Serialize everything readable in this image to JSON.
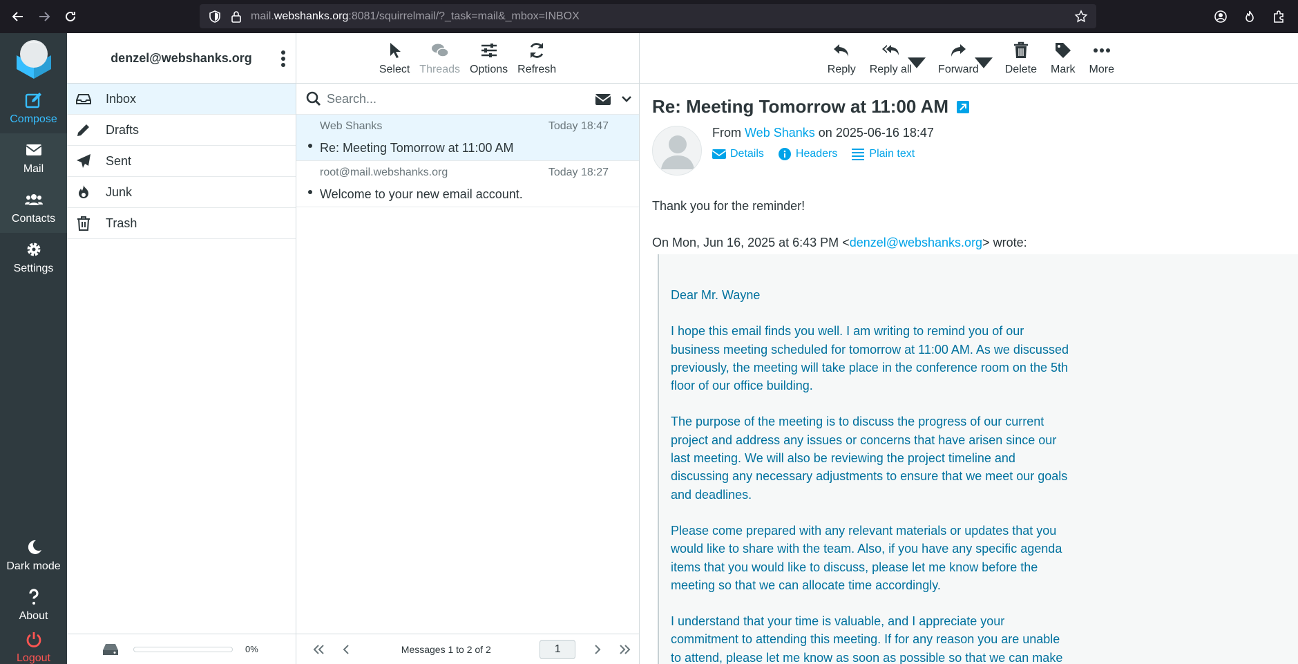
{
  "browser": {
    "url_host": "mail.webshanks.org",
    "url_rest": ":8081/squirrelmail/?_task=mail&_mbox=INBOX",
    "url_prefix": "mail."
  },
  "taskmenu": {
    "items": [
      {
        "label": "Compose",
        "icon": "compose-icon"
      },
      {
        "label": "Mail",
        "icon": "envelope-icon"
      },
      {
        "label": "Contacts",
        "icon": "users-icon"
      },
      {
        "label": "Settings",
        "icon": "gear-icon"
      }
    ],
    "bottom": [
      {
        "label": "Dark mode",
        "icon": "moon-icon"
      },
      {
        "label": "About",
        "icon": "question-icon"
      },
      {
        "label": "Logout",
        "icon": "power-icon"
      }
    ]
  },
  "folders": {
    "account": "denzel@webshanks.org",
    "items": [
      {
        "label": "Inbox",
        "icon": "inbox-icon"
      },
      {
        "label": "Drafts",
        "icon": "pencil-icon"
      },
      {
        "label": "Sent",
        "icon": "paper-plane-icon"
      },
      {
        "label": "Junk",
        "icon": "fire-icon"
      },
      {
        "label": "Trash",
        "icon": "trash-icon"
      }
    ],
    "quota_text": "0%",
    "quota_fraction": 0
  },
  "list_toolbar": {
    "buttons": [
      "Select",
      "Threads",
      "Options",
      "Refresh"
    ]
  },
  "search": {
    "placeholder": "Search..."
  },
  "messages": [
    {
      "from": "Web Shanks",
      "date": "Today 18:47",
      "subject": "Re: Meeting Tomorrow at 11:00 AM"
    },
    {
      "from": "root@mail.webshanks.org",
      "date": "Today 18:27",
      "subject": "Welcome to your new email account."
    }
  ],
  "list_footer": {
    "count": "Messages 1 to 2 of 2",
    "page": "1"
  },
  "content_toolbar": {
    "buttons": [
      "Reply",
      "Reply all",
      "Forward",
      "Delete",
      "Mark",
      "More"
    ]
  },
  "message": {
    "subject": "Re: Meeting Tomorrow at 11:00 AM",
    "from_label": "From",
    "from_name": "Web Shanks",
    "on_label": "on",
    "date": "2025-06-16 18:47",
    "links": [
      "Details",
      "Headers",
      "Plain text"
    ],
    "body": "Thank you for the reminder!",
    "wrote_prefix": "On Mon, Jun 16, 2025 at 6:43 PM <",
    "wrote_email": "denzel@webshanks.org",
    "wrote_suffix": "> wrote:",
    "quote": [
      "Dear Mr. Wayne",
      "I hope this email finds you well. I am writing to remind you of our business meeting scheduled for tomorrow at 11:00 AM. As we discussed previously, the meeting will take place in the conference room on the 5th floor of our office building.",
      "The purpose of the meeting is to discuss the progress of our current project and address any issues or concerns that have arisen since our last meeting. We will also be reviewing the project timeline and discussing any necessary adjustments to ensure that we meet our goals and deadlines.",
      "Please come prepared with any relevant materials or updates that you would like to share with the team. Also, if you have any specific agenda items that you would like to discuss, please let me know before the meeting so that we can allocate time accordingly.",
      "I understand that your time is valuable, and I appreciate your commitment to attending this meeting. If for any reason you are unable to attend, please let me know as soon as possible so that we can make"
    ]
  }
}
